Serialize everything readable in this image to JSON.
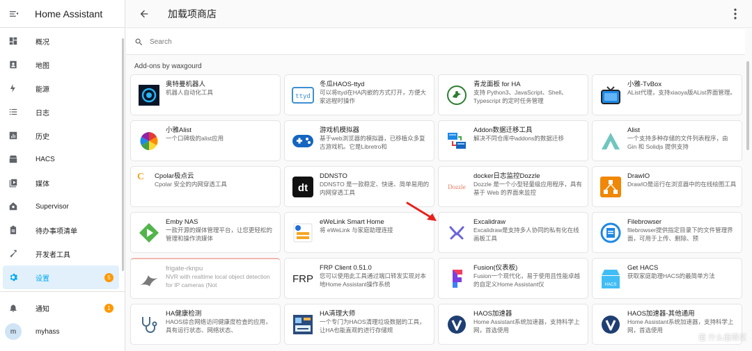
{
  "app": {
    "title": "Home Assistant"
  },
  "sidebar": {
    "items": [
      {
        "label": "概况",
        "icon": "dashboard-icon"
      },
      {
        "label": "地图",
        "icon": "map-icon"
      },
      {
        "label": "能源",
        "icon": "lightning-icon"
      },
      {
        "label": "日志",
        "icon": "logbook-icon"
      },
      {
        "label": "历史",
        "icon": "chart-icon"
      },
      {
        "label": "HACS",
        "icon": "hacs-icon"
      },
      {
        "label": "媒体",
        "icon": "media-icon"
      },
      {
        "label": "Supervisor",
        "icon": "supervisor-icon"
      },
      {
        "label": "待办事项清单",
        "icon": "clipboard-icon"
      },
      {
        "label": "开发者工具",
        "icon": "hammer-icon"
      },
      {
        "label": "设置",
        "icon": "gear-icon",
        "badge": "5",
        "active": true
      }
    ],
    "notifications": {
      "label": "通知",
      "badge": "1"
    },
    "user": {
      "avatar": "m",
      "name": "myhass"
    }
  },
  "page": {
    "title": "加载项商店"
  },
  "search": {
    "placeholder": "Search"
  },
  "section": {
    "title": "Add-ons by waxgourd"
  },
  "addons": [
    {
      "name": "奥特曼机器人",
      "desc": "机器人自动化工具"
    },
    {
      "name": "冬瓜HAOS-ttyd",
      "desc": "可以将ttyd在HA内嵌的方式打开，方便大家远程时操作"
    },
    {
      "name": "青龙面板 for HA",
      "desc": "支持 Python3、JavaScript、Shell、Typescript 的定时任务管理"
    },
    {
      "name": "小雅-TvBox",
      "desc": "AList代理，支持xiaoya版AList界面管理。"
    },
    {
      "name": "小雅Alist",
      "desc": "一个口碑极的alist应用"
    },
    {
      "name": "游戏机模拟器",
      "desc": "基于web浏览器的模拟器，已移植众多复古游戏机。它是Libretro和"
    },
    {
      "name": "Addon数据迁移工具",
      "desc": "解决不同仓库中addons的数据迁移"
    },
    {
      "name": "Alist",
      "desc": "一个支持多种存储的文件列表程序，由 Gin 和 Solidjs 提供支持"
    },
    {
      "name": "Cpolar极点云",
      "desc": "Cpolar 安全的内网穿透工具"
    },
    {
      "name": "DDNSTO",
      "desc": "DDNSTO 是一款稳定、快速、简单易用的内网穿透工具"
    },
    {
      "name": "docker日志监控Dozzle",
      "desc": "Dozzle 是一个小型轻量级应用程序，具有基于 Web 的界面来监控"
    },
    {
      "name": "DrawIO",
      "desc": "DrawIO是运行在浏览器中的在线绘图工具"
    },
    {
      "name": "Emby NAS",
      "desc": "一款开源的媒体管理平台，让您更轻松的管理和操作流媒体"
    },
    {
      "name": "eWeLink Smart Home",
      "desc": "将 eWeLink 与家庭助理连接"
    },
    {
      "name": "Excalidraw",
      "desc": "Excalidraw是支持多人协同的私有化在线画板工具"
    },
    {
      "name": "Filebrowser",
      "desc": "filebrowser提供指定目录下的文件管理界面，可用于上传、删除、预"
    },
    {
      "name": "frigate-rknpu",
      "desc": "NVR with realtime local object detection for IP cameras (Not"
    },
    {
      "name": "FRP Client 0.51.0",
      "desc": "您可以使用此工具通过端口转发实现对本地Home Assistant操作系统"
    },
    {
      "name": "Fusion(仪表板)",
      "desc": "Fusion一个现代化，易于使用且性能卓越的自定义Home Assistant仪"
    },
    {
      "name": "Get HACS",
      "desc": "获取家庭助理HACS的最简单方法"
    },
    {
      "name": "HA健康检测",
      "desc": "HAOS综合网络访问健康度检查的应用，具有运行状态、网络状态、"
    },
    {
      "name": "HA清理大师",
      "desc": "一个专门为HAOS清理垃圾数据的工具，让HA也能直观的进行存储规"
    },
    {
      "name": "HAOS加速器",
      "desc": "Home Assistant系统加速器，支持科学上网，首选使用"
    },
    {
      "name": "HAOS加速器-其他通用",
      "desc": "Home Assistant系统加速器，支持科学上网，首选使用"
    }
  ],
  "logos": {
    "ddnsto": "dt",
    "frp": "FRP",
    "ttyd": "ttyd",
    "dozzle": "Dozzle",
    "cpolar": "C",
    "gethacs": "HACS"
  },
  "watermark": "值 什么值得买",
  "colors": {
    "accent": "#03a9f4",
    "badge": "#ff9800",
    "active_bg": "#e1f0fb"
  }
}
